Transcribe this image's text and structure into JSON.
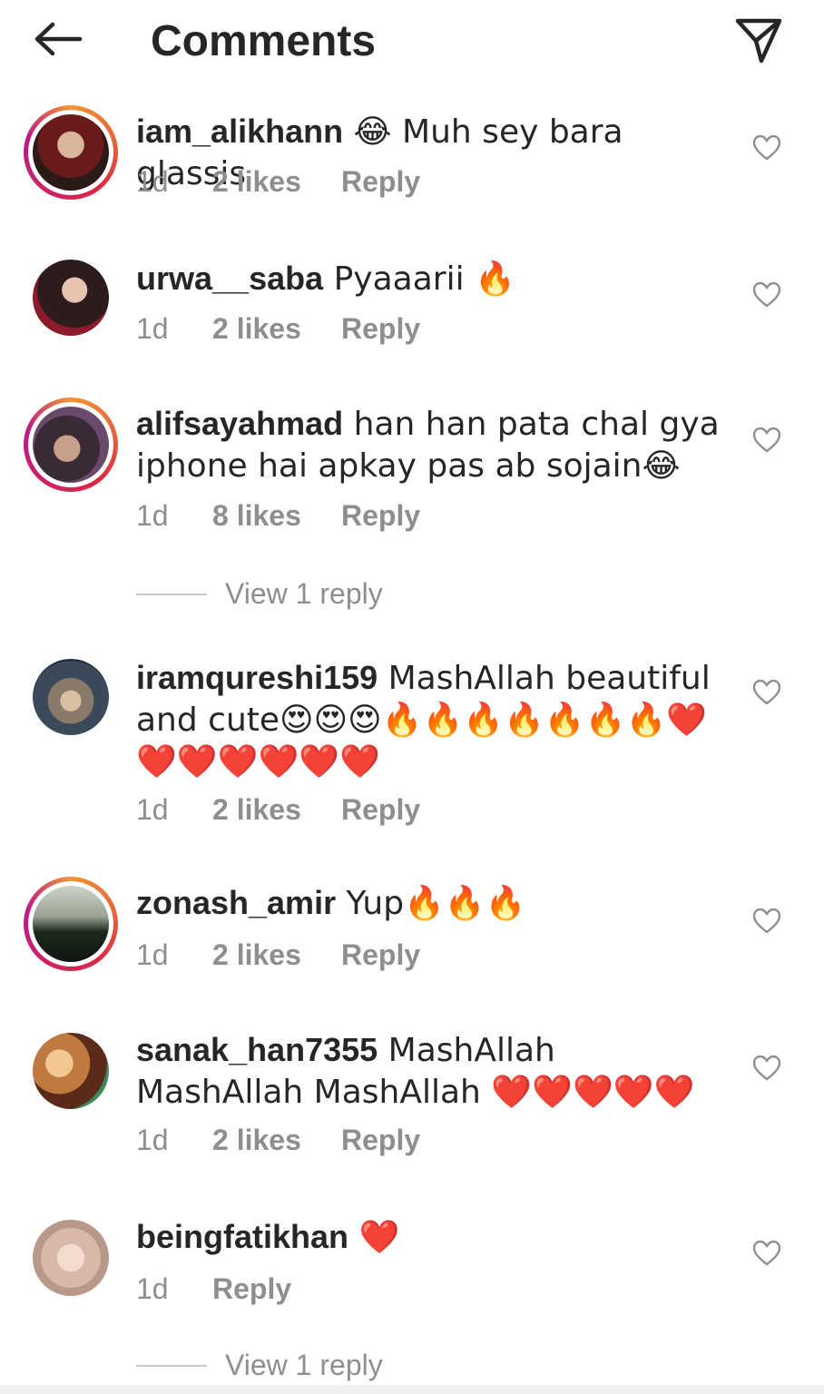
{
  "header": {
    "title": "Comments",
    "back_icon": "arrow-left-icon",
    "share_icon": "paper-plane-icon"
  },
  "colors": {
    "text": "#262626",
    "meta": "#8e8e8e",
    "heart_outline": "#8e8e8e",
    "story_ring_start": "#f09433",
    "story_ring_end": "#bc1888"
  },
  "comments": [
    {
      "username": "iam_alikhann",
      "text": " 😂 Muh sey bara glassis",
      "time": "1d",
      "likes": "2 likes",
      "reply": "Reply",
      "has_story_ring": true
    },
    {
      "username": "urwa__saba",
      "text": " Pyaaarii  🔥",
      "time": "1d",
      "likes": "2 likes",
      "reply": "Reply",
      "has_story_ring": false
    },
    {
      "username": "alifsayahmad",
      "text": " han han pata chal gya iphone hai apkay pas ab sojain😂",
      "time": "1d",
      "likes": "8 likes",
      "reply": "Reply",
      "has_story_ring": true,
      "view_replies": "View 1 reply"
    },
    {
      "username": "iramqureshi159",
      "text": " MashAllah beautiful and cute😍😍😍🔥🔥🔥🔥🔥🔥🔥❤️❤️❤️❤️❤️❤️❤️",
      "time": "1d",
      "likes": "2 likes",
      "reply": "Reply",
      "has_story_ring": false
    },
    {
      "username": "zonash_amir",
      "text": " Yup🔥🔥🔥",
      "time": "1d",
      "likes": "2 likes",
      "reply": "Reply",
      "has_story_ring": true
    },
    {
      "username": "sanak_han7355",
      "text": " MashAllah MashAllah MashAllah ❤️❤️❤️❤️❤️",
      "time": "1d",
      "likes": "2 likes",
      "reply": "Reply",
      "has_story_ring": false
    },
    {
      "username": "beingfatikhan",
      "text": " ❤️",
      "time": "1d",
      "likes": "",
      "reply": "Reply",
      "has_story_ring": false,
      "view_replies": "View 1 reply"
    }
  ]
}
